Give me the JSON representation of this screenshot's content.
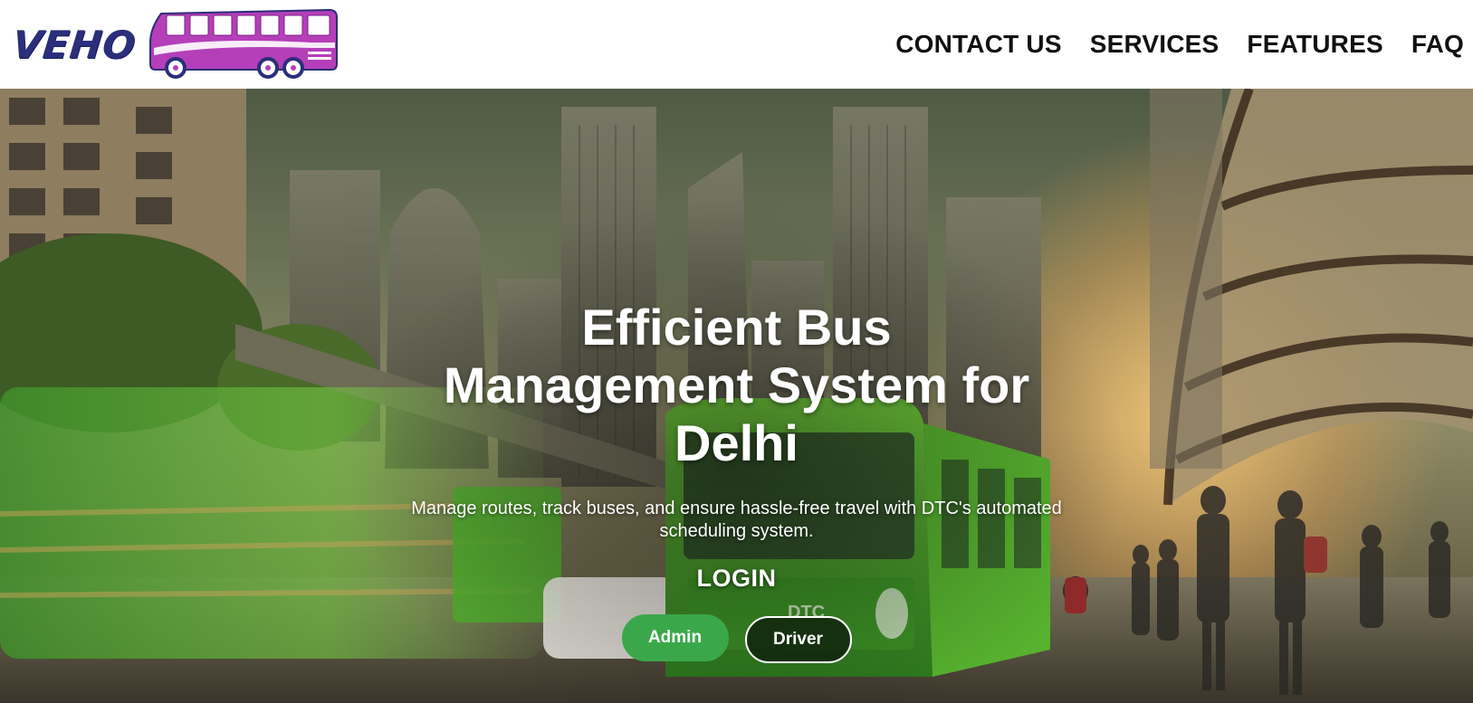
{
  "header": {
    "logo_text": "VEHO",
    "nav": [
      {
        "label": "CONTACT US"
      },
      {
        "label": "SERVICES"
      },
      {
        "label": "FEATURES"
      },
      {
        "label": "FAQ"
      }
    ]
  },
  "hero": {
    "headline": "Efficient Bus Management System for Delhi",
    "subheadline": "Manage routes, track buses, and ensure hassle-free travel with DTC's automated scheduling system.",
    "login_heading": "LOGIN",
    "buttons": {
      "admin": "Admin",
      "driver": "Driver"
    },
    "bus_marking": "DTC"
  },
  "colors": {
    "logo_text": "#2b2e7a",
    "logo_bus": "#b43fb8",
    "admin_button": "#3aa84a",
    "bus_green": "#4fae2d"
  }
}
